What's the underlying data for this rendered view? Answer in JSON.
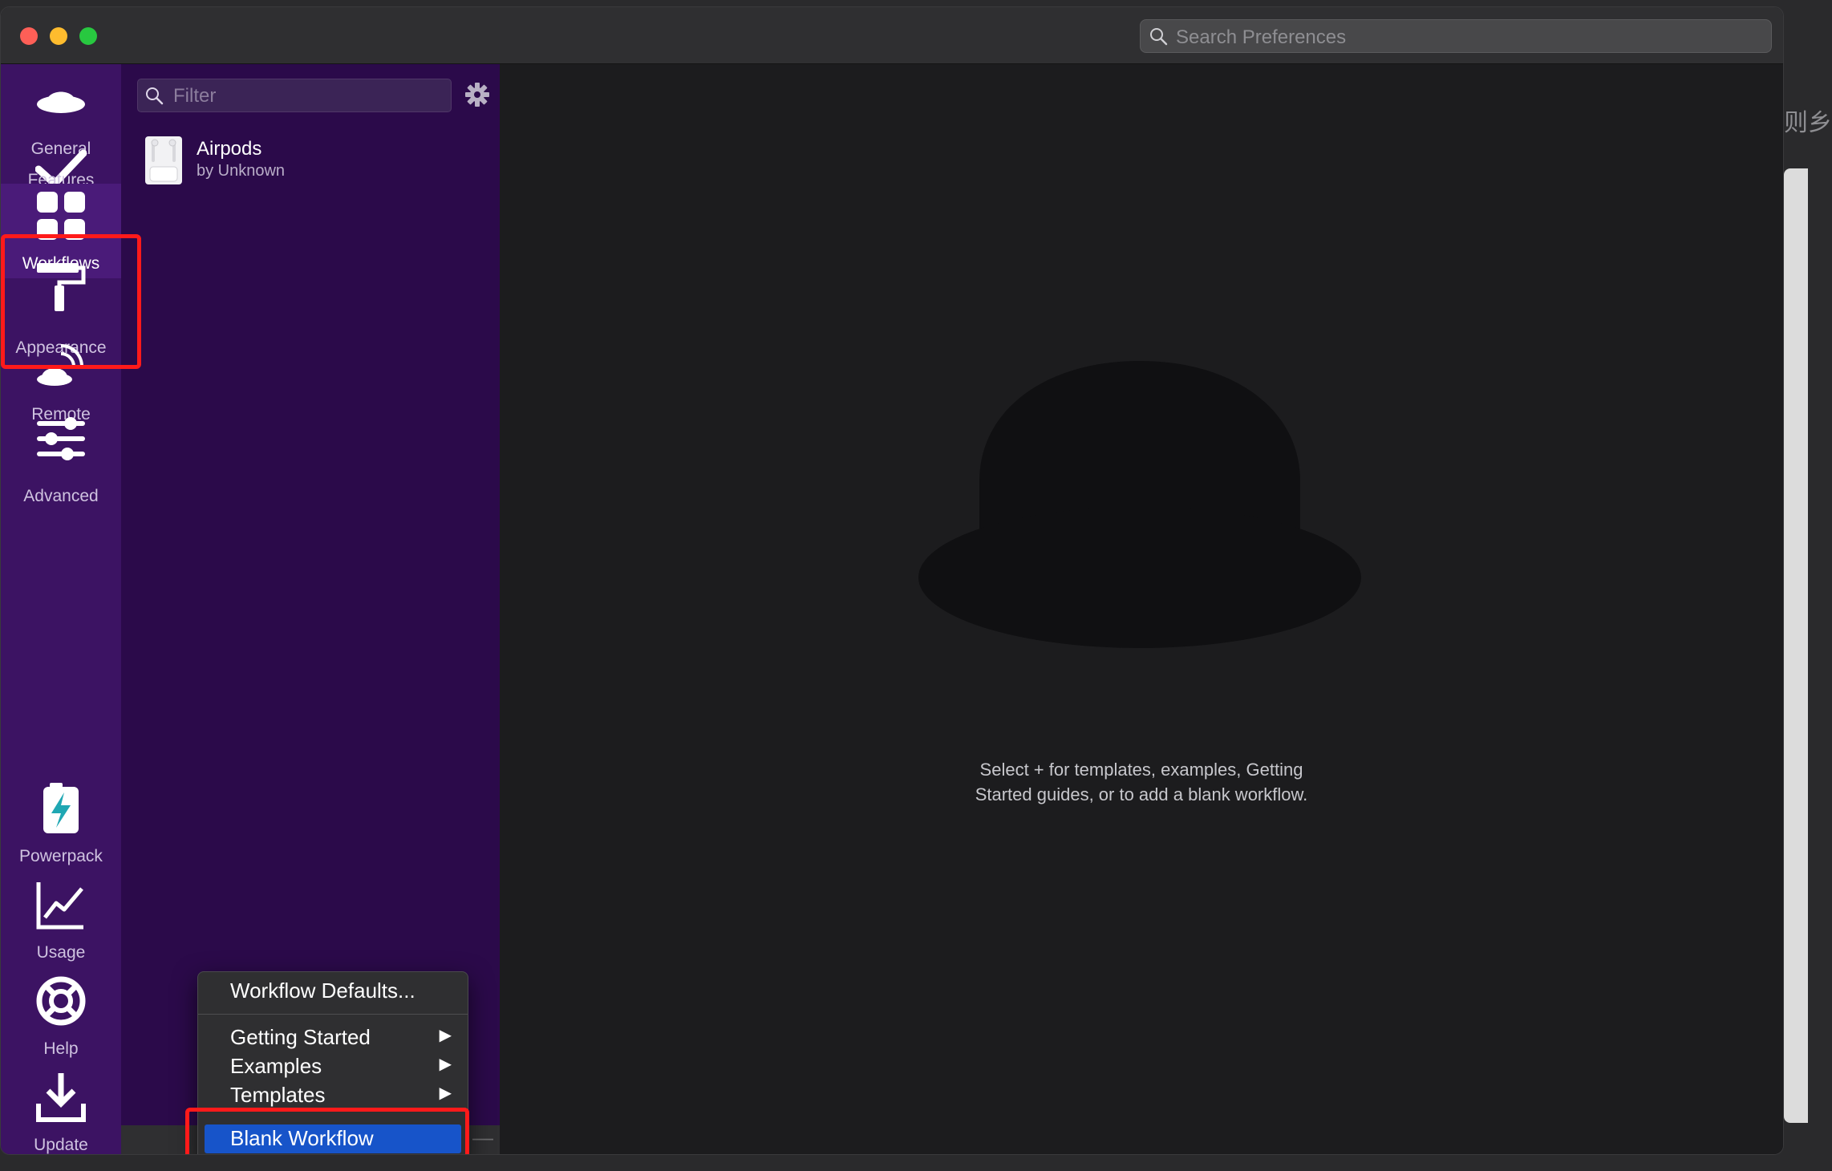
{
  "titlebar": {
    "search_placeholder": "Search Preferences"
  },
  "rail": {
    "items": [
      {
        "label": "General",
        "icon": "hat-icon"
      },
      {
        "label": "Features",
        "icon": "checkmark-icon"
      },
      {
        "label": "Workflows",
        "icon": "grid-icon"
      },
      {
        "label": "Appearance",
        "icon": "paint-roller-icon"
      },
      {
        "label": "Remote",
        "icon": "remote-icon"
      },
      {
        "label": "Advanced",
        "icon": "sliders-icon"
      },
      {
        "label": "Powerpack",
        "icon": "battery-icon"
      },
      {
        "label": "Usage",
        "icon": "chart-icon"
      },
      {
        "label": "Help",
        "icon": "lifebuoy-icon"
      },
      {
        "label": "Update",
        "icon": "download-icon"
      }
    ],
    "active": "Workflows"
  },
  "list": {
    "filter_placeholder": "Filter",
    "workflows": [
      {
        "name": "Airpods",
        "author": "by Unknown"
      }
    ]
  },
  "main": {
    "hint_line1": "Select + for templates, examples, Getting",
    "hint_line2": "Started guides, or to add a blank workflow."
  },
  "menu": {
    "items": [
      {
        "label": "Workflow Defaults...",
        "submenu": false
      },
      {
        "label": "Getting Started",
        "submenu": true
      },
      {
        "label": "Examples",
        "submenu": true
      },
      {
        "label": "Templates",
        "submenu": true
      },
      {
        "label": "Blank Workflow",
        "submenu": false,
        "selected": true
      }
    ],
    "arrow_glyph": "▶"
  },
  "right_glyph": "则乡",
  "colors": {
    "rail_bg": "#3c1363",
    "list_bg": "#2b0a4a",
    "selection": "#1754c9",
    "highlight": "#ff1a1a"
  }
}
